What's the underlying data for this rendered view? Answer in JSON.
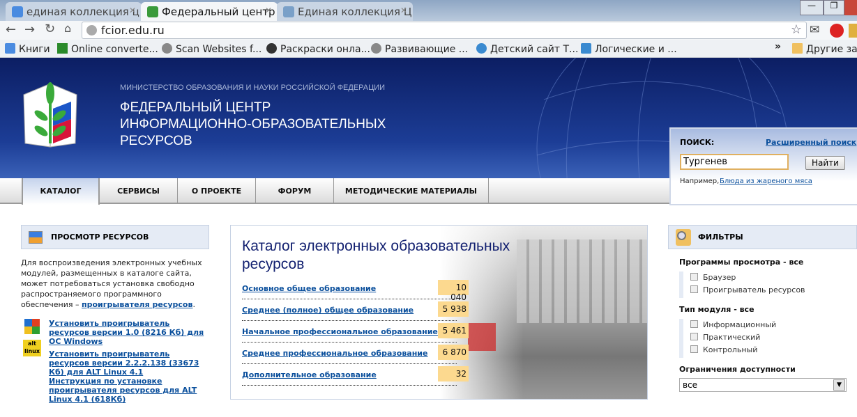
{
  "browser": {
    "tabs": [
      {
        "title": "единая коллекция ц"
      },
      {
        "title": "Федеральный центр"
      },
      {
        "title": "Единая коллекция Ц"
      }
    ],
    "url": "fcior.edu.ru",
    "bookmarks": [
      "Книги",
      "Online converte...",
      "Scan Websites f...",
      "Раскраски онла...",
      "Развивающие ...",
      "Детский сайт Т...",
      "Логические и ..."
    ],
    "more": "»",
    "other_bookmarks": "Другие закладки"
  },
  "header": {
    "ministry": "МИНИСТЕРСТВО ОБРАЗОВАНИЯ И НАУКИ РОССИЙСКОЙ ФЕДЕРАЦИИ",
    "title_lines": [
      "ФЕДЕРАЛЬНЫЙ ЦЕНТР",
      "ИНФОРМАЦИОННО-ОБРАЗОВАТЕЛЬНЫХ",
      "РЕСУРСОВ"
    ]
  },
  "nav": [
    {
      "label": "КАТАЛОГ",
      "active": true
    },
    {
      "label": "СЕРВИСЫ"
    },
    {
      "label": "О ПРОЕКТЕ"
    },
    {
      "label": "ФОРУМ"
    },
    {
      "label": "МЕТОДИЧЕСКИЕ МАТЕРИАЛЫ"
    }
  ],
  "search": {
    "label": "ПОИСК:",
    "advanced": "Расширенный поиск",
    "value": "Тургенев",
    "button": "Найти",
    "example_prefix": "Например,",
    "example_link": "Блюда из жареного мяса"
  },
  "left": {
    "title": "ПРОСМОТР РЕСУРСОВ",
    "text": "Для воспроизведения электронных учебных модулей, размещенных в каталоге сайта, может потребоваться установка свободно распространяемого программного обеспечения –",
    "text_link": "проигрывателя ресурсов",
    "windows_link": "Установить проигрыватель ресурсов версии 1.0 (8216 Кб) для ОС Windows",
    "linux_link": "Установить проигрыватель ресурсов версии 2.2.2.138 (33673 Кб) для ALT Linux 4.1",
    "instruction_link": "Инструкция по установке проигрывателя ресурсов для ALT Linux 4.1 (618Кб)"
  },
  "catalog": {
    "title": "Каталог электронных образовательных ресурсов",
    "items": [
      {
        "label": "Основное общее образование",
        "count": "10 040"
      },
      {
        "label": "Среднее (полное) общее образование",
        "count": "5 938"
      },
      {
        "label": "Начальное профессиональное образование",
        "count": "5 461"
      },
      {
        "label": "Среднее профессиональное образование",
        "count": "6 870"
      },
      {
        "label": "Дополнительное образование",
        "count": "32"
      }
    ]
  },
  "filters": {
    "title": "ФИЛЬТРЫ",
    "groups": [
      {
        "title": "Программы просмотра - все",
        "options": [
          "Браузер",
          "Проигрыватель ресурсов"
        ]
      },
      {
        "title": "Тип модуля - все",
        "options": [
          "Информационный",
          "Практический",
          "Контрольный"
        ]
      }
    ],
    "access_title": "Ограничения доступности",
    "access_value": "все"
  }
}
